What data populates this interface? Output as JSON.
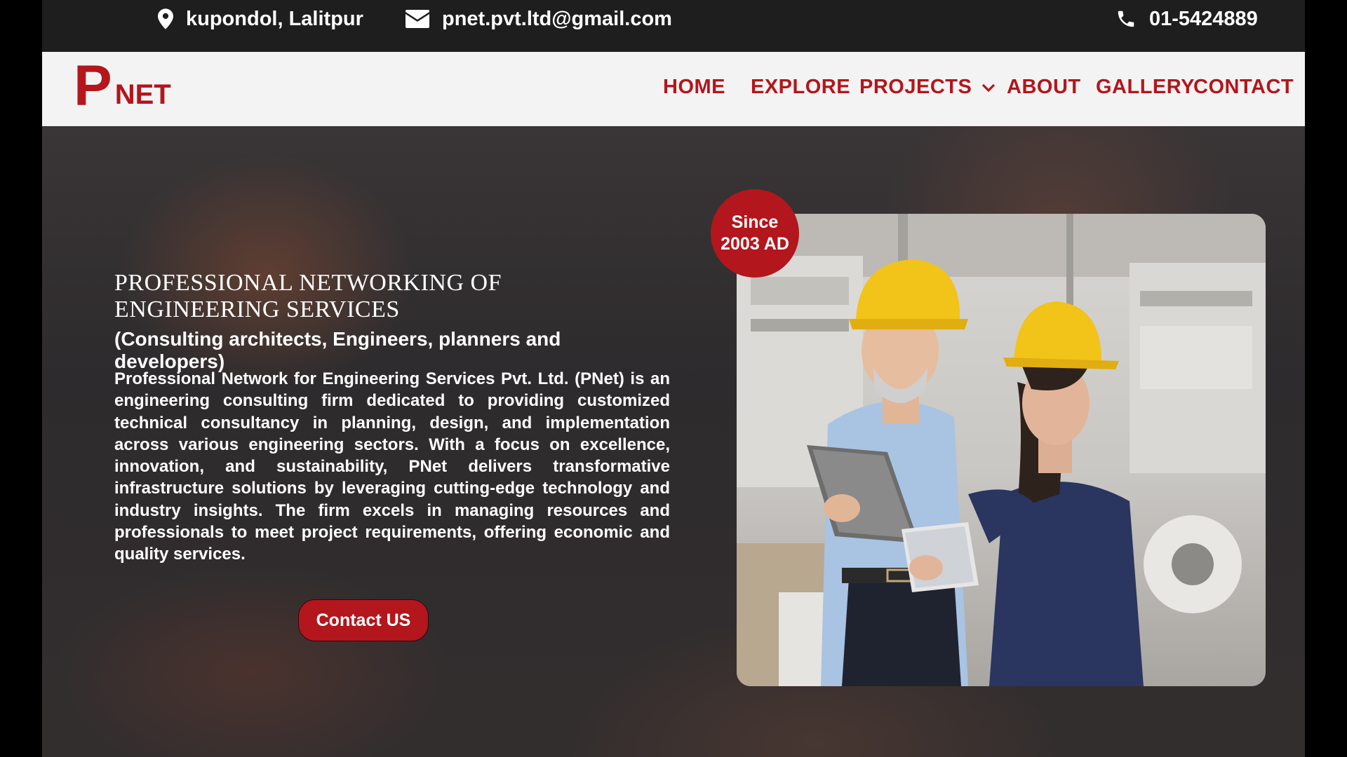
{
  "topbar": {
    "address": "kupondol, Lalitpur",
    "email": "pnet.pvt.ltd@gmail.com",
    "phone": "01-5424889",
    "icons": [
      "map-pin-icon",
      "envelope-icon",
      "phone-icon"
    ]
  },
  "logo": {
    "letter": "P",
    "rest": "NET"
  },
  "nav": {
    "home": "HOME",
    "explore": "EXPLORE",
    "projects": "PROJECTS",
    "about": "ABOUT",
    "gallery": "GALLERY",
    "contact": "CONTACT"
  },
  "hero": {
    "title_line1": "Professional Networking of",
    "title_line2": "Engineering Services",
    "subtitle": "(Consulting architects, Engineers, planners and developers)",
    "description": "Professional Network for Engineering Services Pvt. Ltd. (PNet) is an engineering consulting firm dedicated to providing customized technical consultancy in planning, design, and implementation across various engineering sectors. With a focus on excellence, innovation, and sustainability, PNet delivers transformative infrastructure solutions by leveraging cutting-edge technology and industry insights. The firm excels in managing resources and professionals to meet project requirements, offering economic and quality services.",
    "cta": "Contact US"
  },
  "badge": {
    "line1": "Since",
    "line2": "2003 AD"
  },
  "colors": {
    "brand_red": "#b3161c",
    "topbar_bg": "#1e1e1e",
    "navbar_bg": "#f3f3f3",
    "helmet_yellow": "#f2c318"
  }
}
